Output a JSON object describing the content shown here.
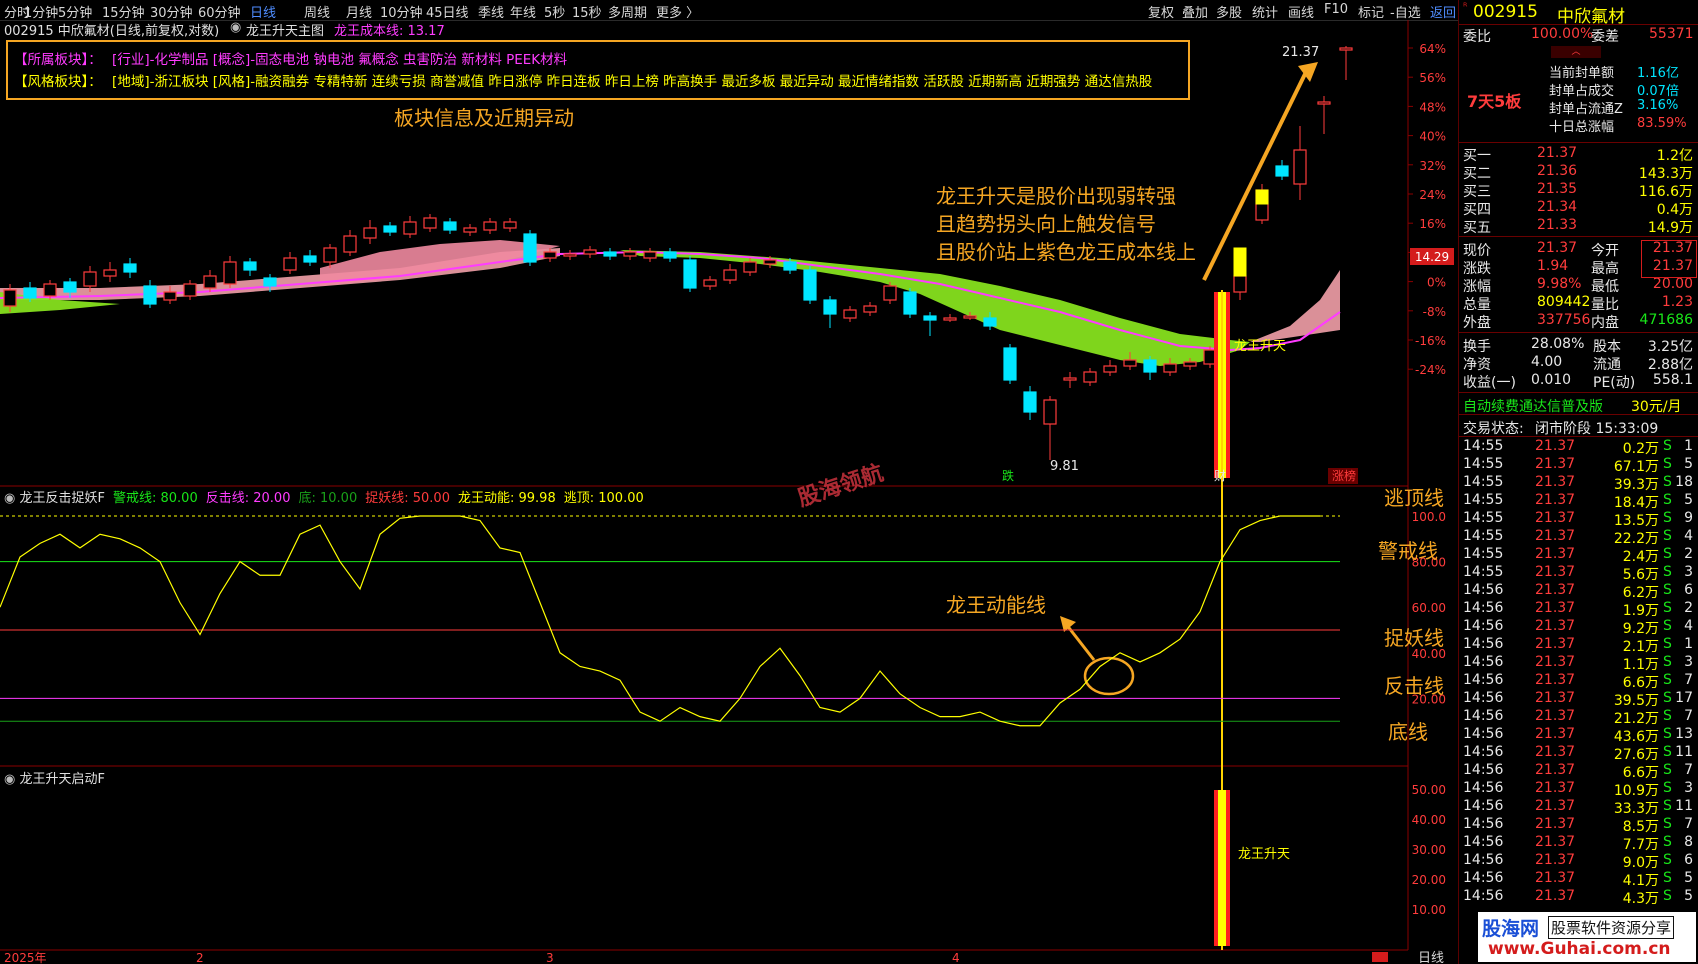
{
  "toolbar": {
    "left_items": [
      "分时",
      "1分钟",
      "5分钟",
      "15分钟",
      "30分钟",
      "60分钟",
      "日线",
      "周线",
      "月线",
      "10分钟",
      "45日线",
      "季线",
      "年线",
      "5秒",
      "15秒",
      "多周期",
      "更多 〉"
    ],
    "right_items": [
      "复权",
      "叠加",
      "多股",
      "统计",
      "画线",
      "F10",
      "标记",
      "-自选",
      "返回"
    ]
  },
  "chart_header": {
    "stock": "002915 中欣氟材(日线,前复权,对数)",
    "indicator_name": "龙王升天主图",
    "cost_line_label": "龙王成本线: 13.17"
  },
  "block_info": {
    "sector_label": "【所属板块】：",
    "sector_text": "[行业]-化学制品 [概念]-固态电池 钠电池 氟概念 虫害防治 新材料 PEEK材料",
    "style_label": "【风格板块】：",
    "style_text": "[地域]-浙江板块 [风格]-融资融券 专精特新 连续亏损 商誉减值 昨日涨停 昨日连板 昨日上榜 昨高换手 最近多板 最近异动 最近情绪指数 活跃股 近期新高 近期强势 通达信热股"
  },
  "annotations": {
    "block_title": "板块信息及近期异动",
    "signal_desc": [
      "龙王升天是股价出现弱转强",
      "且趋势拐头向上触发信号",
      "且股价站上紫色龙王成本线上"
    ],
    "momentum_line": "龙王动能线",
    "escape_line": "逃顶线",
    "alert_line": "警戒线",
    "catch_line": "捉妖线",
    "counter_line": "反击线",
    "bottom_line": "底线",
    "signal_tag": "龙王升天",
    "watermark_cn": "股海领航"
  },
  "price_axis": {
    "ticks": [
      "64%",
      "56%",
      "48%",
      "40%",
      "32%",
      "24%",
      "16%",
      "8%",
      "0%",
      "-8%",
      "-16%",
      "-24%"
    ],
    "current_tag": "14.29",
    "high_label": "21.37",
    "low_label": "9.81"
  },
  "candle_markers": [
    "跌",
    "财",
    "涨榜"
  ],
  "sub1": {
    "title": "龙王反击捉妖F",
    "params": [
      {
        "label": "警戒线:",
        "value": "80.00",
        "color": "#19e619"
      },
      {
        "label": "反击线:",
        "value": "20.00",
        "color": "#ff3cff"
      },
      {
        "label": "底:",
        "value": "10.00",
        "color": "#19a019"
      },
      {
        "label": "捉妖线:",
        "value": "50.00",
        "color": "#ff3c3c"
      },
      {
        "label": "龙王动能:",
        "value": "99.98",
        "color": "#ffff00"
      },
      {
        "label": "逃顶:",
        "value": "100.00",
        "color": "#ffff00"
      }
    ],
    "ticks": [
      "100.0",
      "80.00",
      "60.00",
      "40.00",
      "20.00"
    ]
  },
  "sub2": {
    "title": "龙王升天启动F",
    "ticks": [
      "50.00",
      "40.00",
      "30.00",
      "20.00",
      "10.00"
    ]
  },
  "date_axis": [
    "2025年",
    "2",
    "3",
    "4"
  ],
  "bottom_tab": "日线",
  "quote": {
    "code": "002915",
    "name": "中欣氟材",
    "weibi_label": "委比",
    "weibi": "100.00%",
    "weicha_label": "委差",
    "weicha": "55371",
    "board_tag": "7天5板",
    "seal_rows": [
      {
        "label": "当前封单额",
        "value": "1.16亿"
      },
      {
        "label": "封单占成交",
        "value": "0.07倍"
      },
      {
        "label": "封单占流通Z",
        "value": "3.16%"
      },
      {
        "label": "十日总涨幅",
        "value": "83.59%"
      }
    ],
    "bids": [
      {
        "label": "买一",
        "price": "21.37",
        "vol": "1.2亿"
      },
      {
        "label": "买二",
        "price": "21.36",
        "vol": "143.3万"
      },
      {
        "label": "买三",
        "price": "21.35",
        "vol": "116.6万"
      },
      {
        "label": "买四",
        "price": "21.34",
        "vol": "0.4万"
      },
      {
        "label": "买五",
        "price": "21.33",
        "vol": "14.9万"
      }
    ],
    "stats": [
      {
        "l1": "现价",
        "v1": "21.37",
        "l2": "今开",
        "v2": "21.37"
      },
      {
        "l1": "涨跌",
        "v1": "1.94",
        "l2": "最高",
        "v2": "21.37"
      },
      {
        "l1": "涨幅",
        "v1": "9.98%",
        "l2": "最低",
        "v2": "20.00"
      },
      {
        "l1": "总量",
        "v1": "809442",
        "l2": "量比",
        "v2": "1.23"
      },
      {
        "l1": "外盘",
        "v1": "337756",
        "l2": "内盘",
        "v2": "471686"
      }
    ],
    "stats2": [
      {
        "l1": "换手",
        "v1": "28.08%",
        "l2": "股本",
        "v2": "3.25亿"
      },
      {
        "l1": "净资",
        "v1": "4.00",
        "l2": "流通",
        "v2": "2.88亿"
      },
      {
        "l1": "收益(一)",
        "v1": "0.010",
        "l2": "PE(动)",
        "v2": "558.1"
      }
    ],
    "promo": "自动续费通达信普及版",
    "promo_price": "30元/月",
    "status_label": "交易状态:",
    "status": "闭市阶段 15:33:09",
    "ticks": [
      {
        "t": "14:55",
        "p": "21.37",
        "v": "0.2万",
        "s": "S",
        "n": "1"
      },
      {
        "t": "14:55",
        "p": "21.37",
        "v": "67.1万",
        "s": "S",
        "n": "5"
      },
      {
        "t": "14:55",
        "p": "21.37",
        "v": "39.3万",
        "s": "S",
        "n": "18"
      },
      {
        "t": "14:55",
        "p": "21.37",
        "v": "18.4万",
        "s": "S",
        "n": "5"
      },
      {
        "t": "14:55",
        "p": "21.37",
        "v": "13.5万",
        "s": "S",
        "n": "9"
      },
      {
        "t": "14:55",
        "p": "21.37",
        "v": "22.2万",
        "s": "S",
        "n": "4"
      },
      {
        "t": "14:55",
        "p": "21.37",
        "v": "2.4万",
        "s": "S",
        "n": "2"
      },
      {
        "t": "14:55",
        "p": "21.37",
        "v": "5.6万",
        "s": "S",
        "n": "3"
      },
      {
        "t": "14:56",
        "p": "21.37",
        "v": "6.2万",
        "s": "S",
        "n": "6"
      },
      {
        "t": "14:56",
        "p": "21.37",
        "v": "1.9万",
        "s": "S",
        "n": "2"
      },
      {
        "t": "14:56",
        "p": "21.37",
        "v": "9.2万",
        "s": "S",
        "n": "4"
      },
      {
        "t": "14:56",
        "p": "21.37",
        "v": "2.1万",
        "s": "S",
        "n": "1"
      },
      {
        "t": "14:56",
        "p": "21.37",
        "v": "1.1万",
        "s": "S",
        "n": "3"
      },
      {
        "t": "14:56",
        "p": "21.37",
        "v": "6.6万",
        "s": "S",
        "n": "7"
      },
      {
        "t": "14:56",
        "p": "21.37",
        "v": "39.5万",
        "s": "S",
        "n": "17"
      },
      {
        "t": "14:56",
        "p": "21.37",
        "v": "21.2万",
        "s": "S",
        "n": "7"
      },
      {
        "t": "14:56",
        "p": "21.37",
        "v": "43.6万",
        "s": "S",
        "n": "13"
      },
      {
        "t": "14:56",
        "p": "21.37",
        "v": "27.6万",
        "s": "S",
        "n": "11"
      },
      {
        "t": "14:56",
        "p": "21.37",
        "v": "6.6万",
        "s": "S",
        "n": "7"
      },
      {
        "t": "14:56",
        "p": "21.37",
        "v": "10.9万",
        "s": "S",
        "n": "3"
      },
      {
        "t": "14:56",
        "p": "21.37",
        "v": "33.3万",
        "s": "S",
        "n": "11"
      },
      {
        "t": "14:56",
        "p": "21.37",
        "v": "8.5万",
        "s": "S",
        "n": "7"
      },
      {
        "t": "14:56",
        "p": "21.37",
        "v": "7.7万",
        "s": "S",
        "n": "8"
      },
      {
        "t": "14:56",
        "p": "21.37",
        "v": "9.0万",
        "s": "S",
        "n": "6"
      },
      {
        "t": "14:56",
        "p": "21.37",
        "v": "4.1万",
        "s": "S",
        "n": "5"
      },
      {
        "t": "14:56",
        "p": "21.37",
        "v": "4.3万",
        "s": "S",
        "n": "5"
      }
    ],
    "watermark_brand": "股海网",
    "watermark_tag": "股票软件资源分享",
    "watermark_url": "www.Guhai.com.cn"
  }
}
